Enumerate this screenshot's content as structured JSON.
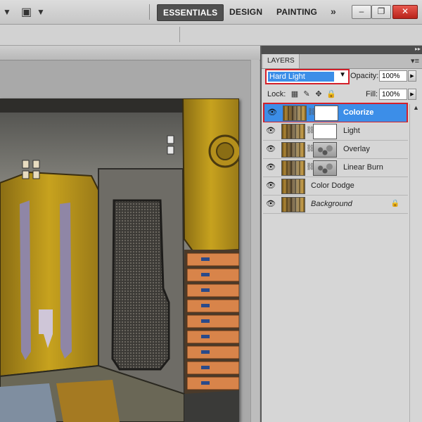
{
  "toolbar": {
    "workspaces": [
      {
        "label": "ESSENTIALS",
        "active": true
      },
      {
        "label": "DESIGN",
        "active": false
      },
      {
        "label": "PAINTING",
        "active": false
      }
    ],
    "more_icon": "double-chevron-right-icon",
    "window_buttons": {
      "minimize": "–",
      "restore": "❐",
      "close": "✕"
    }
  },
  "layers_panel": {
    "tab_label": "LAYERS",
    "blend_mode": "Hard Light",
    "opacity_label": "Opacity:",
    "opacity_value": "100%",
    "lock_label": "Lock:",
    "fill_label": "Fill:",
    "fill_value": "100%",
    "layers": [
      {
        "name": "Colorize",
        "selected": true,
        "mask": "white",
        "italic": false,
        "locked": false
      },
      {
        "name": "Light",
        "selected": false,
        "mask": "white",
        "italic": false,
        "locked": false
      },
      {
        "name": "Overlay",
        "selected": false,
        "mask": "noisy",
        "italic": false,
        "locked": false
      },
      {
        "name": "Linear Burn",
        "selected": false,
        "mask": "noisy",
        "italic": false,
        "locked": false
      },
      {
        "name": "Color Dodge",
        "selected": false,
        "mask": "none",
        "italic": false,
        "locked": false
      },
      {
        "name": "Background",
        "selected": false,
        "mask": "none",
        "italic": true,
        "locked": true
      }
    ]
  },
  "colors": {
    "selection": "#3c8ee8",
    "highlight_border": "#d4202a",
    "workspace_active": "#505050"
  }
}
